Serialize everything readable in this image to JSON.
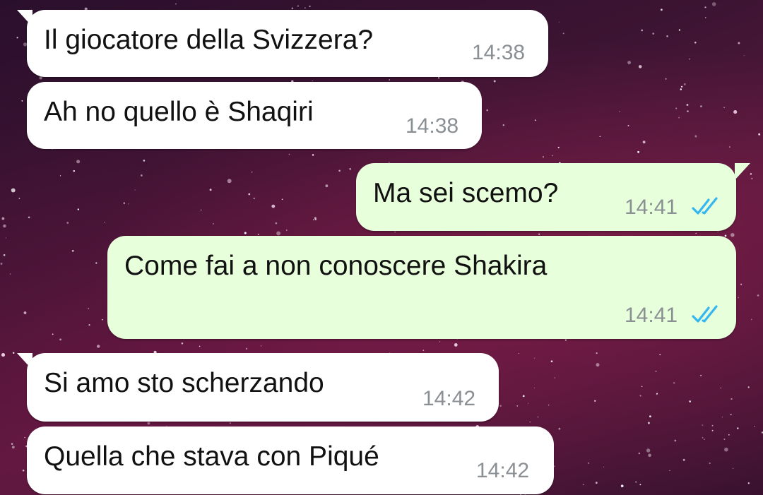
{
  "messages": [
    {
      "text": "Il giocatore della Svizzera?",
      "time": "14:38",
      "direction": "incoming"
    },
    {
      "text": "Ah no quello è Shaqiri",
      "time": "14:38",
      "direction": "incoming"
    },
    {
      "text": "Ma sei scemo?",
      "time": "14:41",
      "direction": "outgoing",
      "status": "read"
    },
    {
      "text": "Come fai a non conoscere Shakira",
      "time": "14:41",
      "direction": "outgoing",
      "status": "read"
    },
    {
      "text": "Si amo sto scherzando",
      "time": "14:42",
      "direction": "incoming"
    },
    {
      "text": "Quella che stava con Piqué",
      "time": "14:42",
      "direction": "incoming"
    }
  ],
  "colors": {
    "incoming_bubble": "#ffffff",
    "outgoing_bubble": "#e7ffdb",
    "read_ticks": "#34b7f1",
    "timestamp": "#8a8f93"
  },
  "icons": {
    "read_receipt": "double-check-icon"
  }
}
